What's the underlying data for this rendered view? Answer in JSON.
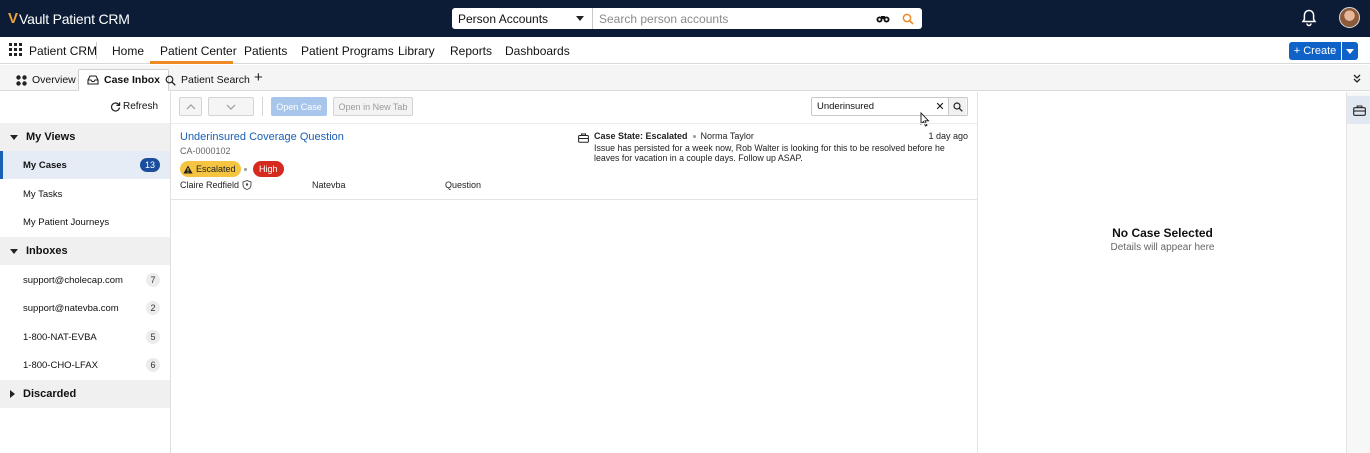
{
  "app": {
    "brand_letter": "V",
    "brand_name": "Vault Patient CRM"
  },
  "search": {
    "scope": "Person Accounts",
    "placeholder": "Search person accounts",
    "value": ""
  },
  "nav": {
    "app_label": "Patient CRM",
    "items": [
      "Home",
      "Patient Center",
      "Patients",
      "Patient Programs",
      "Library",
      "Reports",
      "Dashboards"
    ],
    "active": "Patient Center",
    "create_label": "+ Create"
  },
  "tabs": [
    {
      "label": "Overview",
      "icon": "overview-icon"
    },
    {
      "label": "Case Inbox",
      "icon": "inbox-icon",
      "active": true
    },
    {
      "label": "Patient Search",
      "icon": "search-icon"
    }
  ],
  "sidebar": {
    "refresh_label": "Refresh",
    "sections": [
      {
        "label": "My Views",
        "expanded": true,
        "items": [
          {
            "label": "My Cases",
            "count": "13",
            "active": true
          },
          {
            "label": "My Tasks",
            "count": ""
          },
          {
            "label": "My Patient Journeys",
            "count": ""
          }
        ]
      },
      {
        "label": "Inboxes",
        "expanded": true,
        "items": [
          {
            "label": "support@cholecap.com",
            "count": "7"
          },
          {
            "label": "support@natevba.com",
            "count": "2"
          },
          {
            "label": "1-800-NAT-EVBA",
            "count": "5"
          },
          {
            "label": "1-800-CHO-LFAX",
            "count": "6"
          }
        ]
      },
      {
        "label": "Discarded",
        "expanded": false,
        "items": []
      }
    ]
  },
  "toolbar": {
    "open_case": "Open Case",
    "open_new_tab": "Open in New Tab",
    "filter_value": "Underinsured"
  },
  "case": {
    "title": "Underinsured Coverage Question",
    "id": "CA-0000102",
    "status": "Escalated",
    "priority": "High",
    "patient": "Claire Redfield",
    "product": "Natevba",
    "type": "Question",
    "state_label": "Case State: Escalated",
    "owner": "Norma Taylor",
    "age": "1 day ago",
    "description": "Issue has persisted for a week now, Rob Walter is looking for this to be resolved before he leaves for vacation in a couple days. Follow up ASAP."
  },
  "detail": {
    "title": "No Case Selected",
    "subtitle": "Details will appear here"
  },
  "colors": {
    "topbar": "#0c1b36",
    "accent": "#f08a24",
    "primary": "#0f62c8",
    "escalated": "#f5c542",
    "high": "#d62a1e",
    "link": "#1a5fb4"
  }
}
